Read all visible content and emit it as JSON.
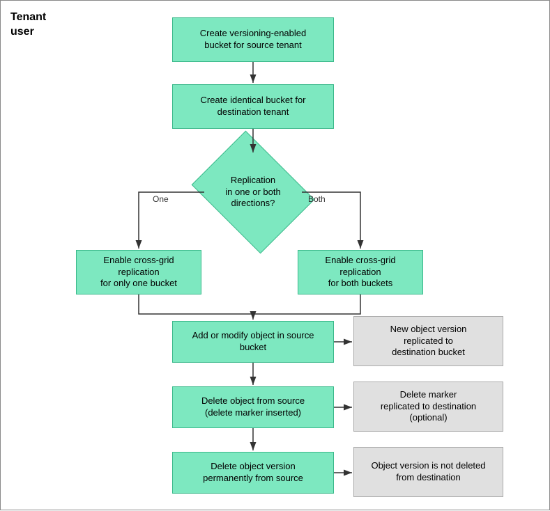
{
  "title": "Tenant\nuser",
  "boxes": {
    "box1": {
      "label": "Create versioning-enabled\nbucket for source tenant"
    },
    "box2": {
      "label": "Create identical bucket for\ndestination tenant"
    },
    "diamond": {
      "label": "Replication\nin one or both\ndirections?"
    },
    "one_label": {
      "text": "One"
    },
    "both_label": {
      "text": "Both"
    },
    "box3": {
      "label": "Enable cross-grid replication\nfor only one bucket"
    },
    "box4": {
      "label": "Enable cross-grid replication\nfor both buckets"
    },
    "box5": {
      "label": "Add or modify object in source\nbucket"
    },
    "side1": {
      "label": "New object version\nreplicated to\ndestination bucket"
    },
    "box6": {
      "label": "Delete object from source\n(delete marker inserted)"
    },
    "side2": {
      "label": "Delete marker\nreplicated to destination\n(optional)"
    },
    "box7": {
      "label": "Delete object version\npermanently from source"
    },
    "side3": {
      "label": "Object version is not deleted\nfrom destination"
    }
  }
}
